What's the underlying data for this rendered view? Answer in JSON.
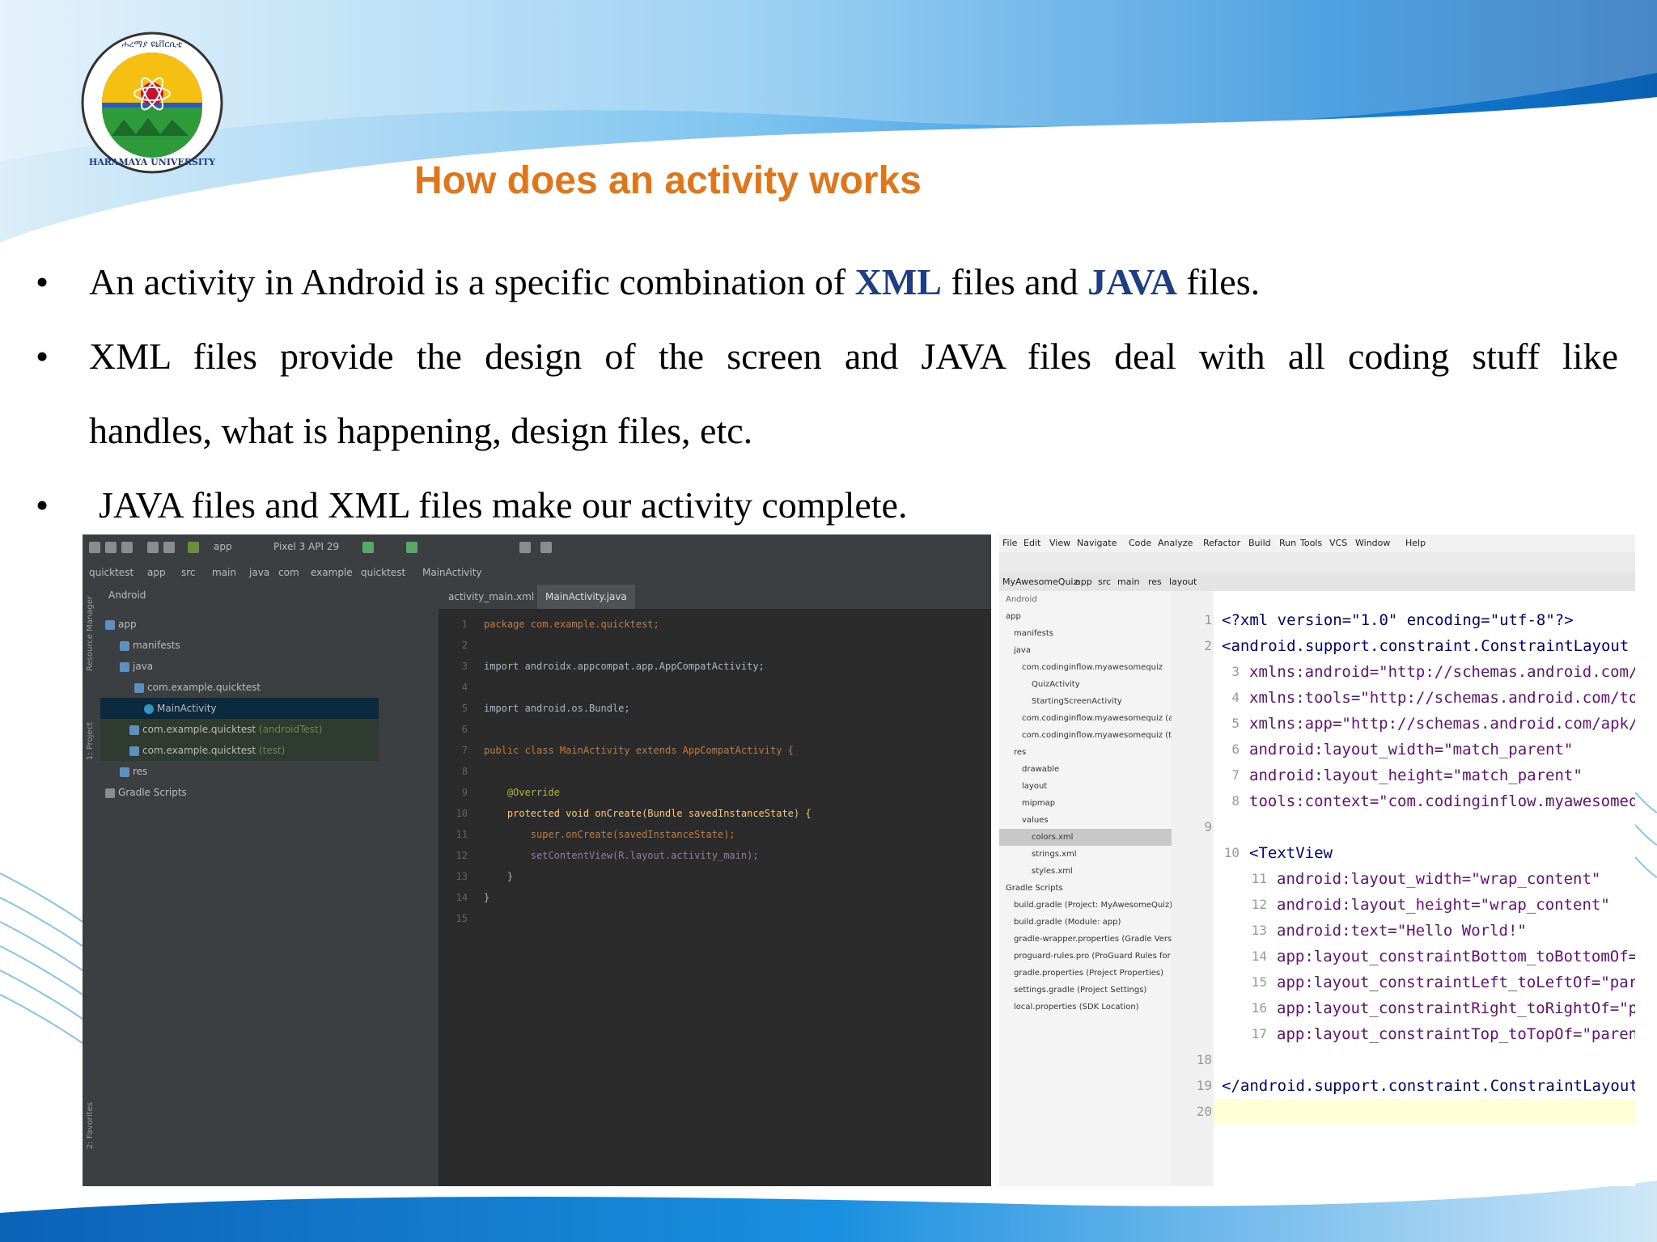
{
  "slide": {
    "logo_text": "HARAMAYA UNIVERSITY",
    "logo_script": "ሐረማያ ዩኒቨርሲቲ",
    "title": "How does an activity works",
    "bullet_symbol": "•",
    "bullet1": {
      "pre": "An activity in Android is a specific combination of ",
      "b1": "XML",
      "mid": " files and ",
      "b2": "JAVA",
      "post": " files."
    },
    "bullet2_line1": "XML files provide the design of the screen and JAVA files deal with all coding stuff like",
    "bullet2_line2": "handles, what is happening, design files, etc.",
    "bullet3": "JAVA files and XML files make our activity complete."
  },
  "ide_left": {
    "toolbar": {
      "app": "app",
      "device": "Pixel 3 API 29"
    },
    "breadcrumb": [
      "quicktest",
      "app",
      "src",
      "main",
      "java",
      "com",
      "example",
      "quicktest",
      "MainActivity"
    ],
    "view_selector": "Android",
    "tabs": [
      "activity_main.xml",
      "MainActivity.java"
    ],
    "side_labels": [
      "Resource Manager",
      "1: Project",
      "2: Favorites"
    ],
    "tree": [
      {
        "label": "app"
      },
      {
        "label": "manifests"
      },
      {
        "label": "java"
      },
      {
        "label": "com.example.quicktest"
      },
      {
        "label": "MainActivity"
      },
      {
        "label": "com.example.quicktest",
        "suffix": "(androidTest)"
      },
      {
        "label": "com.example.quicktest",
        "suffix": "(test)"
      },
      {
        "label": "res"
      },
      {
        "label": "Gradle Scripts"
      }
    ],
    "code": [
      {
        "n": "1",
        "t": "package com.example.quicktest;"
      },
      {
        "n": "2",
        "t": ""
      },
      {
        "n": "3",
        "t": "import androidx.appcompat.app.AppCompatActivity;"
      },
      {
        "n": "4",
        "t": ""
      },
      {
        "n": "5",
        "t": "import android.os.Bundle;"
      },
      {
        "n": "6",
        "t": ""
      },
      {
        "n": "7",
        "t": "public class MainActivity extends AppCompatActivity {"
      },
      {
        "n": "8",
        "t": ""
      },
      {
        "n": "9",
        "t": "    @Override"
      },
      {
        "n": "10",
        "t": "    protected void onCreate(Bundle savedInstanceState) {"
      },
      {
        "n": "11",
        "t": "        super.onCreate(savedInstanceState);"
      },
      {
        "n": "12",
        "t": "        setContentView(R.layout.activity_main);"
      },
      {
        "n": "13",
        "t": "    }"
      },
      {
        "n": "14",
        "t": "}"
      },
      {
        "n": "15",
        "t": ""
      }
    ]
  },
  "ide_right": {
    "menu": [
      "File",
      "Edit",
      "View",
      "Navigate",
      "Code",
      "Analyze",
      "Refactor",
      "Build",
      "Run",
      "Tools",
      "VCS",
      "Window",
      "Help"
    ],
    "crumbs": [
      "MyAwesomeQuiz",
      "app",
      "src",
      "main",
      "res",
      "layout"
    ],
    "view_selector": "Android",
    "tree": [
      {
        "label": "app"
      },
      {
        "label": "manifests"
      },
      {
        "label": "java"
      },
      {
        "label": "com.codinginflow.myawesomequiz"
      },
      {
        "label": "QuizActivity"
      },
      {
        "label": "StartingScreenActivity"
      },
      {
        "label": "com.codinginflow.myawesomequiz (androidTest)"
      },
      {
        "label": "com.codinginflow.myawesomequiz (test)"
      },
      {
        "label": "res"
      },
      {
        "label": "drawable"
      },
      {
        "label": "layout"
      },
      {
        "label": "mipmap"
      },
      {
        "label": "values"
      },
      {
        "label": "colors.xml"
      },
      {
        "label": "strings.xml"
      },
      {
        "label": "styles.xml"
      },
      {
        "label": "Gradle Scripts"
      },
      {
        "label": "build.gradle (Project: MyAwesomeQuiz)"
      },
      {
        "label": "build.gradle (Module: app)"
      },
      {
        "label": "gradle-wrapper.properties (Gradle Version)"
      },
      {
        "label": "proguard-rules.pro (ProGuard Rules for app)"
      },
      {
        "label": "gradle.properties (Project Properties)"
      },
      {
        "label": "settings.gradle (Project Settings)"
      },
      {
        "label": "local.properties (SDK Location)"
      }
    ],
    "xml": [
      {
        "n": "1",
        "t": "<?xml version=\"1.0\" encoding=\"utf-8\"?>",
        "i": 0
      },
      {
        "n": "2",
        "t": "<android.support.constraint.ConstraintLayout",
        "i": 0
      },
      {
        "n": "3",
        "t": "xmlns:android=\"http://schemas.android.com/apk/res/android\"",
        "i": 1
      },
      {
        "n": "4",
        "t": "xmlns:tools=\"http://schemas.android.com/tools\"",
        "i": 1
      },
      {
        "n": "5",
        "t": "xmlns:app=\"http://schemas.android.com/apk/res-auto\"",
        "i": 1
      },
      {
        "n": "6",
        "t": "android:layout_width=\"match_parent\"",
        "i": 1
      },
      {
        "n": "7",
        "t": "android:layout_height=\"match_parent\"",
        "i": 1
      },
      {
        "n": "8",
        "t": "tools:context=\"com.codinginflow.myawesomequiz.StartingScreenActivity\">",
        "i": 1
      },
      {
        "n": "9",
        "t": "",
        "i": 0
      },
      {
        "n": "10",
        "t": "<TextView",
        "i": 1
      },
      {
        "n": "11",
        "t": "android:layout_width=\"wrap_content\"",
        "i": 2
      },
      {
        "n": "12",
        "t": "android:layout_height=\"wrap_content\"",
        "i": 2
      },
      {
        "n": "13",
        "t": "android:text=\"Hello World!\"",
        "i": 2
      },
      {
        "n": "14",
        "t": "app:layout_constraintBottom_toBottomOf=\"parent\"",
        "i": 2
      },
      {
        "n": "15",
        "t": "app:layout_constraintLeft_toLeftOf=\"parent\"",
        "i": 2
      },
      {
        "n": "16",
        "t": "app:layout_constraintRight_toRightOf=\"parent\"",
        "i": 2
      },
      {
        "n": "17",
        "t": "app:layout_constraintTop_toTopOf=\"parent\" />",
        "i": 2
      },
      {
        "n": "18",
        "t": "",
        "i": 0
      },
      {
        "n": "19",
        "t": "</android.support.constraint.ConstraintLayout>",
        "i": 0
      },
      {
        "n": "20",
        "t": "",
        "i": 0
      }
    ]
  },
  "colors": {
    "title": "#E0761B",
    "bold_blue": "#1F3D82",
    "wave_dark": "#0E6CC4",
    "wave_light": "#7FC4F0"
  }
}
